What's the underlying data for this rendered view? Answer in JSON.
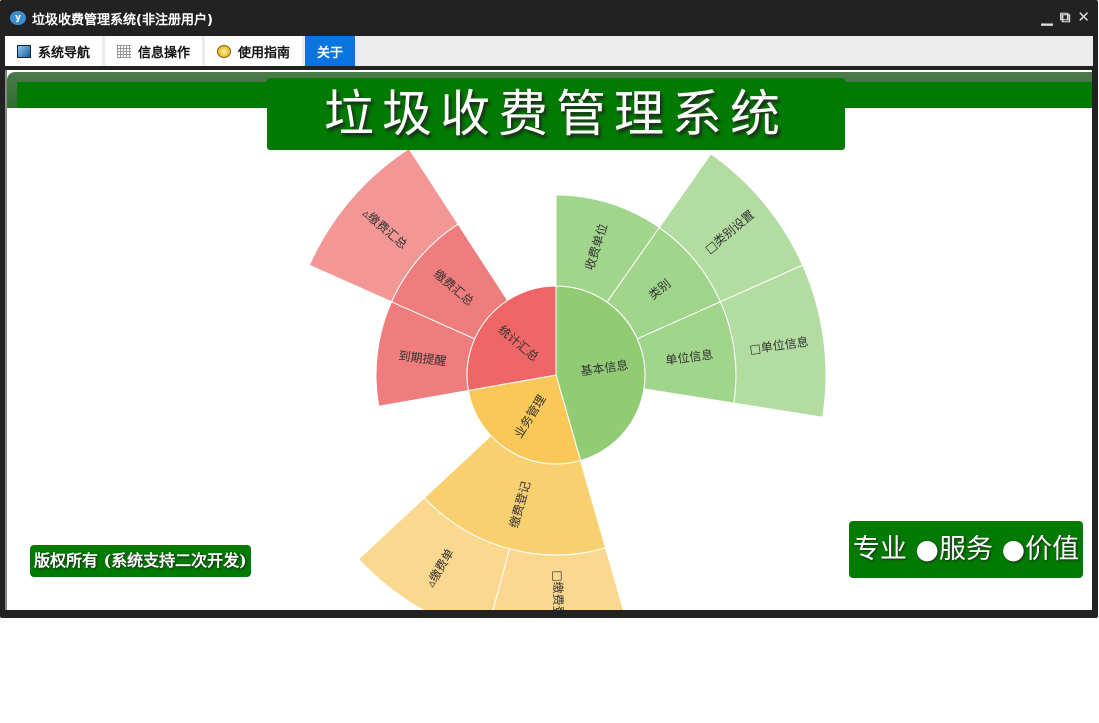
{
  "window": {
    "title": "垃圾收费管理系统(非注册用户)",
    "logo": "y",
    "controls": [
      "minimize-icon",
      "restore-icon",
      "close-icon"
    ]
  },
  "tabs": [
    {
      "label": "系统导航",
      "icon": "monitor-icon"
    },
    {
      "label": "信息操作",
      "icon": "grid-icon"
    },
    {
      "label": "使用指南",
      "icon": "help-icon"
    },
    {
      "label": "关于",
      "active": true
    }
  ],
  "header": {
    "title": "垃圾收费管理系统"
  },
  "footer": {
    "copyright": "版权所有 (系统支持二次开发)",
    "slogan": "专业 ●服务 ●价值"
  },
  "colors": {
    "green": "#007a00",
    "tab_active": "#0a74e0"
  },
  "chart_data": {
    "type": "sunburst",
    "unit": "degrees",
    "nodes": [
      {
        "name": "基本信息",
        "value": 164,
        "colors": [
          "#91cc75",
          "#a0d58b",
          "#b3dca1"
        ],
        "children": [
          {
            "name": "收费单位",
            "value": 35
          },
          {
            "name": "类别",
            "value": 31,
            "children": [
              {
                "name": "□类别设置",
                "value": 31
              }
            ]
          },
          {
            "name": "单位信息",
            "value": 33,
            "children": [
              {
                "name": "□单位信息",
                "value": 33
              }
            ]
          }
        ]
      },
      {
        "name": "业务管理",
        "value": 96,
        "colors": [
          "#fac858",
          "#f9d06f",
          "#fad88f"
        ],
        "children": [
          {
            "name": "缴费登记",
            "value": 63,
            "children": [
              {
                "name": "□缴费登记",
                "value": 31
              },
              {
                "name": "▵缴费单",
                "value": 32
              }
            ]
          }
        ]
      },
      {
        "name": "统计汇总",
        "value": 100,
        "colors": [
          "#ee6666",
          "#f07d7d",
          "#f29696"
        ],
        "children": [
          {
            "name": "到期提醒",
            "value": 34
          },
          {
            "name": "缴费汇总",
            "value": 33,
            "children": [
              {
                "name": "▵缴费汇总",
                "value": 33
              }
            ]
          }
        ]
      }
    ]
  }
}
